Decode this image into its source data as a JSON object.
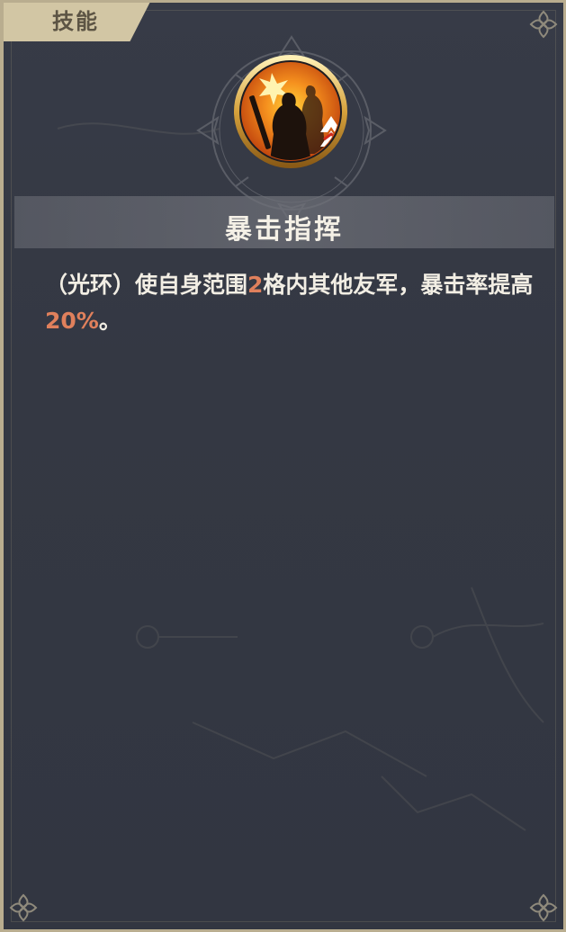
{
  "tab": {
    "label": "技能"
  },
  "skill": {
    "name": "暴击指挥",
    "icon": "crit-command-skill-icon",
    "description": {
      "part1": "（光环）使自身范围",
      "range_value": "2",
      "part2": "格内其他友军，暴击率提高",
      "crit_value": "20%",
      "part3": "。"
    }
  },
  "colors": {
    "panel_bg": "#353944",
    "border": "#b9ad8f",
    "tab_bg": "#d2c6a4",
    "highlight": "#e0805c",
    "text": "#f2eee4"
  }
}
